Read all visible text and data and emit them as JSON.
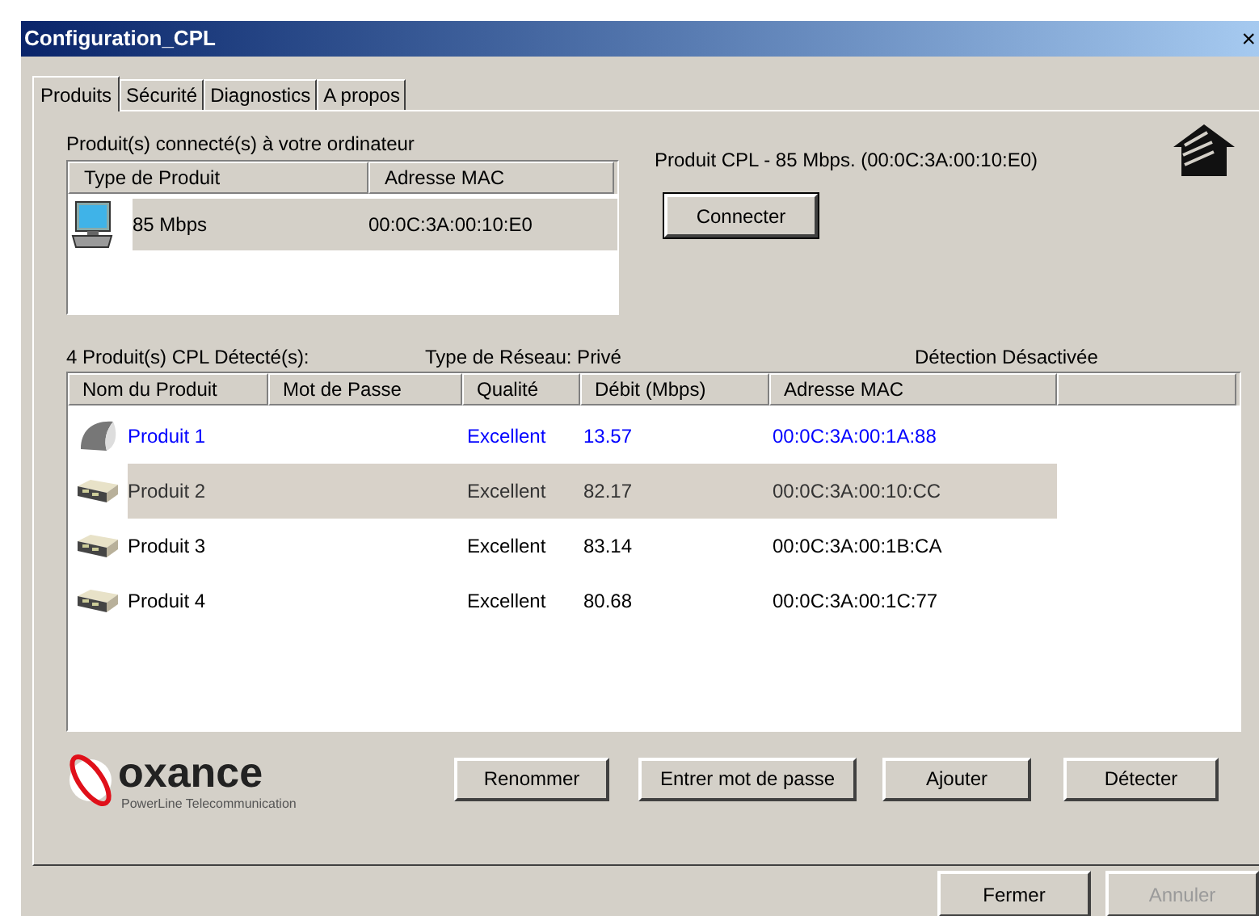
{
  "window": {
    "title": "Configuration_CPL",
    "close": "×"
  },
  "tabs": [
    {
      "label": "Produits",
      "selected": true
    },
    {
      "label": "Sécurité",
      "selected": false
    },
    {
      "label": "Diagnostics",
      "selected": false
    },
    {
      "label": "A propos",
      "selected": false
    }
  ],
  "connected": {
    "label": "Produit(s) connecté(s) à votre ordinateur",
    "columns": [
      "Type de Produit",
      "Adresse MAC"
    ],
    "rows": [
      {
        "type": "85 Mbps",
        "mac": "00:0C:3A:00:10:E0",
        "selected": true
      }
    ],
    "info": "Produit CPL -  85 Mbps. (00:0C:3A:00:10:E0)",
    "button": "Connecter"
  },
  "detected": {
    "count": "4 Produit(s) CPL Détecté(s):",
    "network": "Type de Réseau: Privé",
    "detection": "Détection Désactivée",
    "columns": [
      "Nom du Produit",
      "Mot de Passe",
      "Qualité",
      "Débit (Mbps)",
      "Adresse MAC"
    ],
    "rows": [
      {
        "kind": "adapter",
        "name": "Produit 1",
        "quality": "Excellent",
        "rate": "13.57",
        "mac": "00:0C:3A:00:1A:88",
        "local": true,
        "selected": false
      },
      {
        "kind": "plug",
        "name": "Produit 2",
        "quality": "Excellent",
        "rate": "82.17",
        "mac": "00:0C:3A:00:10:CC",
        "local": false,
        "selected": true
      },
      {
        "kind": "plug",
        "name": "Produit 3",
        "quality": "Excellent",
        "rate": "83.14",
        "mac": "00:0C:3A:00:1B:CA",
        "local": false,
        "selected": false
      },
      {
        "kind": "plug",
        "name": "Produit 4",
        "quality": "Excellent",
        "rate": "80.68",
        "mac": "00:0C:3A:00:1C:77",
        "local": false,
        "selected": false
      }
    ]
  },
  "logo": {
    "name": "oxance",
    "tagline": "PowerLine Telecommunication"
  },
  "actions": [
    "Renommer",
    "Entrer mot de passe",
    "Ajouter",
    "Détecter"
  ],
  "footer": [
    {
      "label": "Fermer",
      "disabled": false
    },
    {
      "label": "Annuler",
      "disabled": true
    }
  ]
}
